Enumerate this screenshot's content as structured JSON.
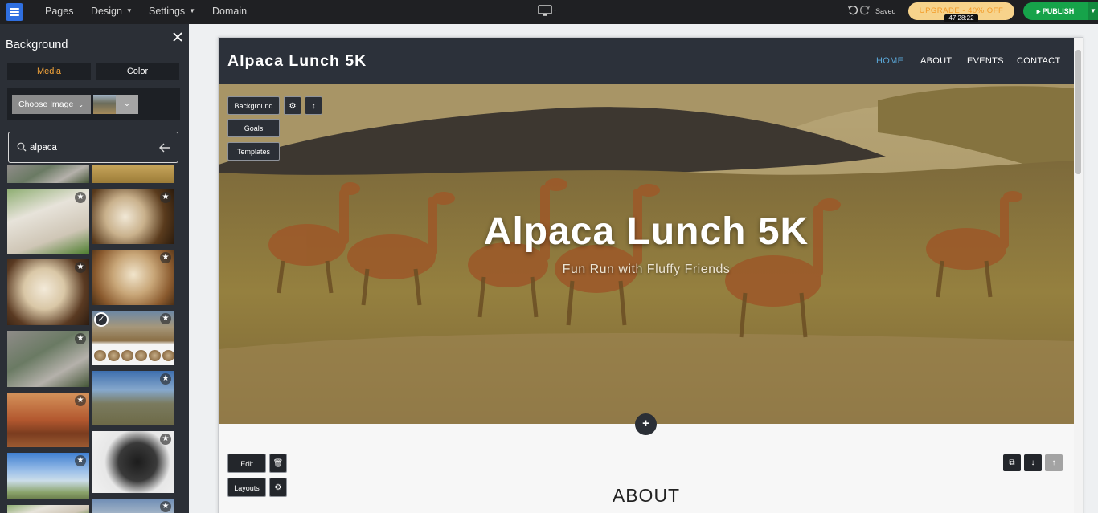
{
  "topbar": {
    "nav": [
      "Pages",
      "Design",
      "Settings",
      "Domain"
    ],
    "saved_label": "Saved",
    "upgrade_label": "UPGRADE - 40% OFF",
    "upgrade_timer": "47:28:22",
    "publish_label": "PUBLISH",
    "brand_color": "#2f6fe0",
    "publish_color": "#16a34a"
  },
  "sidebar": {
    "title": "Background",
    "tabs": {
      "media": "Media",
      "color": "Color"
    },
    "choose_image": "Choose Image",
    "search": {
      "value": "alpaca",
      "placeholder": "Search"
    },
    "thumbnails_left": [
      "alpaca-closeup",
      "alpaca-smiling",
      "alpaca-mountain",
      "alpacas-desert",
      "alpacas-sky"
    ],
    "thumbnails_right": [
      "alpaca-field",
      "alpaca-brown",
      "alpaca-face",
      "alpacas-herd-selected",
      "alpacas-plain",
      "alpaca-black"
    ]
  },
  "site": {
    "logo": "Alpaca Lunch 5K",
    "nav": {
      "home": "HOME",
      "about": "ABOUT",
      "events": "EVENTS",
      "contact": "CONTACT"
    },
    "active_nav": "HOME",
    "hero": {
      "title": "Alpaca Lunch 5K",
      "subtitle": "Fun Run with Fluffy Friends"
    },
    "hero_tools": {
      "background": "Background",
      "goals": "Goals",
      "templates": "Templates"
    },
    "section_tools": {
      "edit": "Edit",
      "layouts": "Layouts"
    },
    "about_title": "ABOUT"
  }
}
